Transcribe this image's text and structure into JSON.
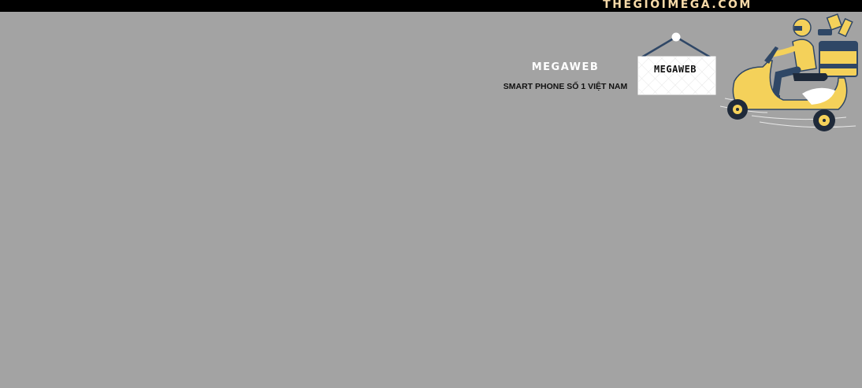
{
  "header": {
    "site_name": "THEGIOIMEGA.COM"
  },
  "hero": {
    "brand_title": "MEGAWEB",
    "brand_subtitle": "SMART PHONE SỐ 1 VIỆT NAM",
    "sign_text": "MEGAWEB"
  },
  "colors": {
    "background": "#a3a3a3",
    "topbar": "#000000",
    "site_name": "#f6d9a8",
    "scooter_yellow": "#f4d15a",
    "navy": "#2f4766"
  }
}
